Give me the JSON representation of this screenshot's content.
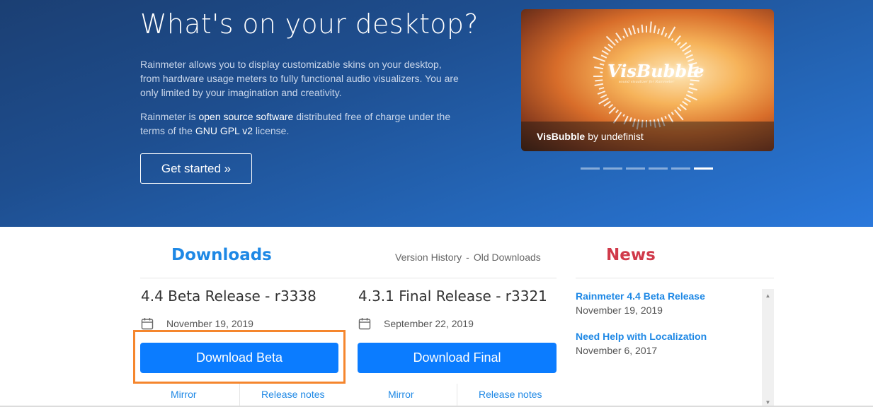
{
  "hero": {
    "title": "What's on your desktop?",
    "paragraph1": "Rainmeter allows you to display customizable skins on your desktop, from hardware usage meters to fully functional audio visualizers. You are only limited by your imagination and creativity.",
    "paragraph2_pre": "Rainmeter is ",
    "paragraph2_bold1": "open source software",
    "paragraph2_mid": " distributed free of charge under the terms of the ",
    "paragraph2_bold2": "GNU GPL v2",
    "paragraph2_post": " license.",
    "get_started_label": "Get started »"
  },
  "slideshow": {
    "logo_text": "VisBubble",
    "tagline": "sound visualizer for Rainmeter",
    "caption_skin": "VisBubble",
    "caption_author": "by undefinist",
    "dot_count": 6,
    "active_index": 5
  },
  "downloads": {
    "title": "Downloads",
    "version_history": "Version History",
    "separator": "-",
    "old_downloads": "Old Downloads",
    "beta": {
      "title": "4.4 Beta Release - r3338",
      "date": "November 19, 2019",
      "button": "Download Beta",
      "mirror": "Mirror",
      "release_notes": "Release notes"
    },
    "final": {
      "title": "4.3.1 Final Release - r3321",
      "date": "September 22, 2019",
      "button": "Download Final",
      "mirror": "Mirror",
      "release_notes": "Release notes"
    }
  },
  "news": {
    "title": "News",
    "items": [
      {
        "title": "Rainmeter 4.4 Beta Release",
        "date": "November 19, 2019"
      },
      {
        "title": "Need Help with Localization",
        "date": "November 6, 2017"
      }
    ]
  },
  "colors": {
    "accent_blue": "#0b7cff",
    "link_blue": "#1e88e5",
    "news_red": "#d0394a",
    "highlight_orange": "#f5862d"
  }
}
